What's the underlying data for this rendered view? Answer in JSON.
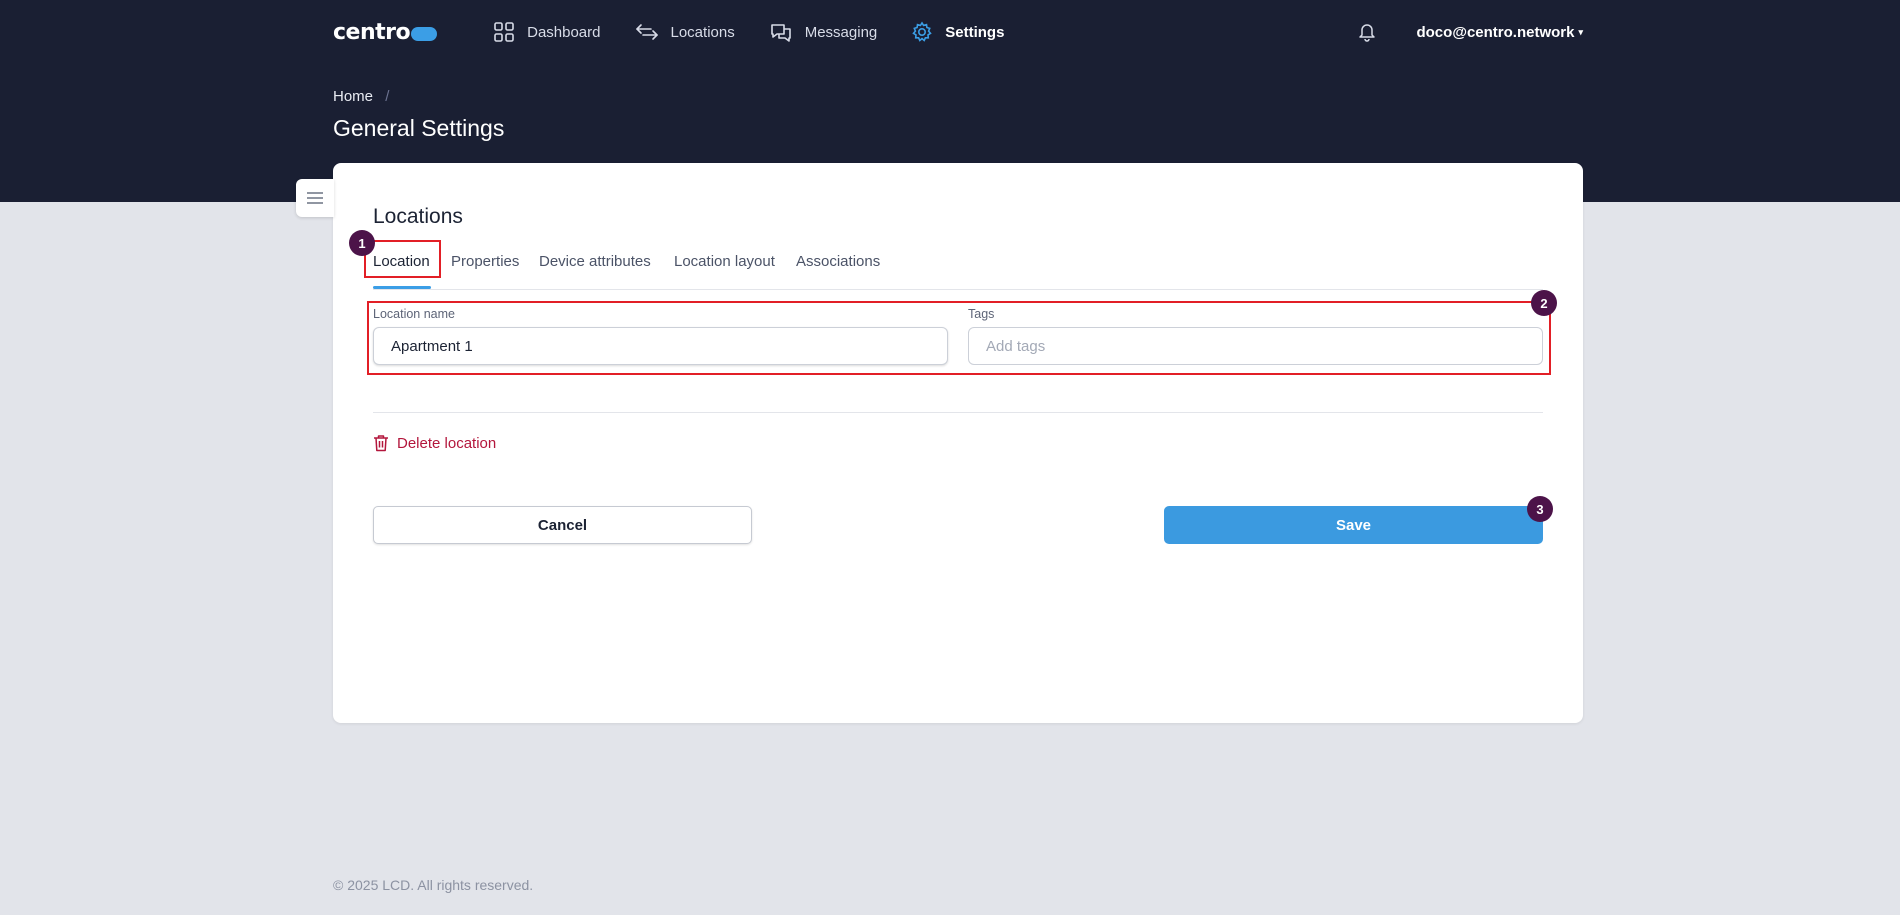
{
  "brand": {
    "logo_text": "centro",
    "accent_color": "#3b9ee6"
  },
  "nav": {
    "items": [
      {
        "label": "Dashboard",
        "icon": "grid-icon"
      },
      {
        "label": "Locations",
        "icon": "arrows-swap-icon"
      },
      {
        "label": "Messaging",
        "icon": "chat-bubbles-icon"
      },
      {
        "label": "Settings",
        "icon": "gear-icon",
        "active": true
      }
    ],
    "user_email": "doco@centro.network"
  },
  "breadcrumb": {
    "home": "Home",
    "separator": "/"
  },
  "page": {
    "title": "General Settings"
  },
  "card": {
    "title": "Locations",
    "tabs": [
      "Location",
      "Properties",
      "Device attributes",
      "Location layout",
      "Associations"
    ],
    "active_tab": "Location",
    "form": {
      "location_name_label": "Location name",
      "location_name_value": "Apartment 1",
      "tags_label": "Tags",
      "tags_placeholder": "Add tags"
    },
    "delete_label": "Delete location",
    "cancel_label": "Cancel",
    "save_label": "Save"
  },
  "annotations": {
    "markers": [
      "1",
      "2",
      "3"
    ],
    "marker_color": "#4c1349",
    "box_color": "#e21f26"
  },
  "footer": {
    "copyright": "© 2025 LCD. All rights reserved."
  }
}
